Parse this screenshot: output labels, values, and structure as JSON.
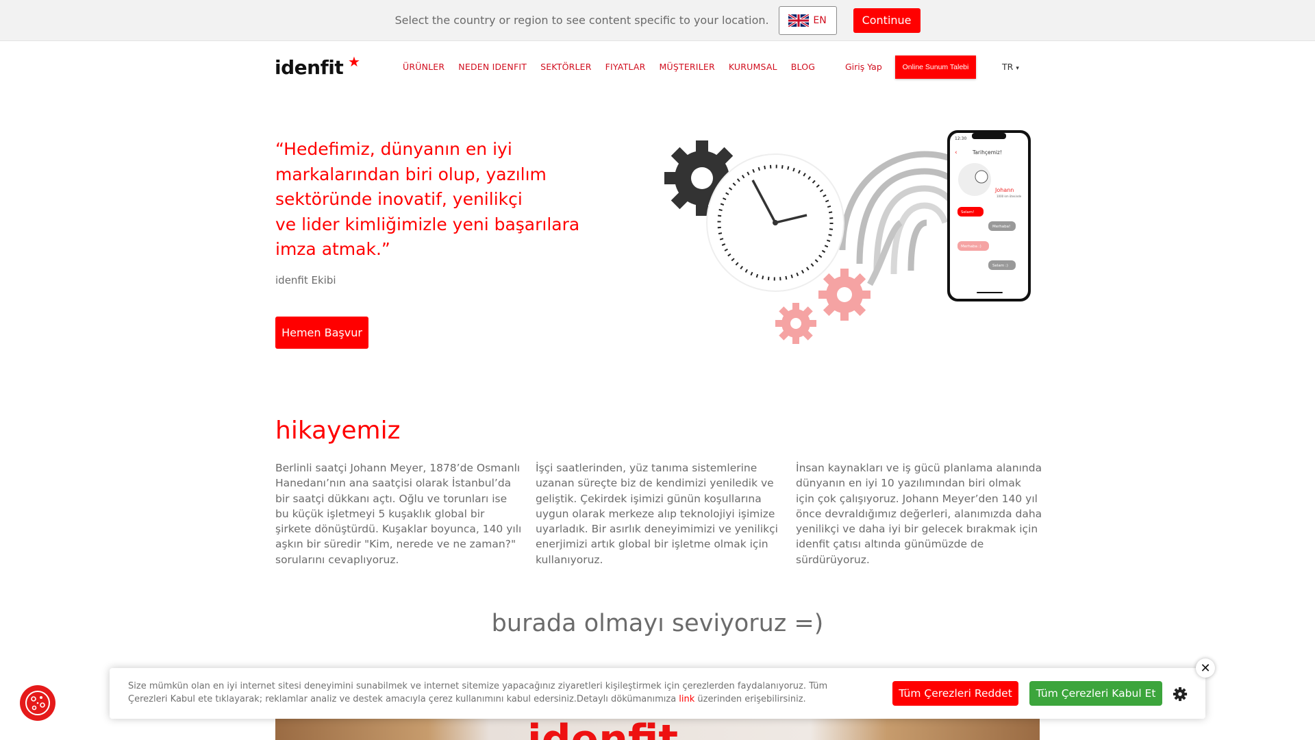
{
  "country_bar": {
    "message": "Select the country or region to see content specific to your location.",
    "language_code": "EN",
    "language_flag_icon": "uk-flag-icon",
    "continue_label": "Continue"
  },
  "header": {
    "logo": "idenfit",
    "nav": [
      "ÜRÜNLER",
      "NEDEN IDENFIT",
      "SEKTÖRLER",
      "FIYATLAR",
      "MÜŞTERILER",
      "KURUMSAL",
      "BLOG"
    ],
    "login_label": "Giriş Yap",
    "demo_button_label": "Online Sunum Talebi",
    "language_label": "TR"
  },
  "hero": {
    "quote_lines": [
      "“Hedefimiz, dünyanın en iyi",
      "markalarından biri olup, yazılım",
      "sektöründe inovatif, yenilikçi",
      "ve lider kimliğimizle yeni başarılara",
      "imza atmak.”"
    ],
    "author": "idenfit Ekibi",
    "apply_button_label": "Hemen Başvur",
    "phone_screen": {
      "time": "12:30",
      "title": "Tarihçemiz!",
      "name": "Johann",
      "subtitle": "1000 km ötesinde",
      "bubbles": [
        "Selam!",
        "Merhaba!",
        "Merhaba :)",
        "Selam :)"
      ]
    }
  },
  "story": {
    "title": "hikayemiz",
    "columns": [
      "Berlinli saatçi Johann Meyer, 1878’de Osmanlı Hanedanı’nın ana saatçisi olarak İstanbul’da bir saatçi dükkanı açtı. Oğlu ve torunları ise bu küçük işletmeyi 5 kuşaklık global bir şirkete dönüştürdü. Kuşaklar boyunca, 140 yılı aşkın bir süredir \"Kim, nerede ve ne zaman?\" sorularını cevaplıyoruz.",
      "İşçi saatlerinden, yüz tanıma sistemlerine uzanan süreçte biz de kendimizi yeniledik ve geliştik. Çekirdek işimizi günün koşullarına uygun olarak merkeze alıp teknolojiyi işimize uyarladık. Bir asırlık deneyimimizi ve yenilikçi enerjimizi artık global bir işletme olmak için kullanıyoruz.",
      "İnsan kaynakları ve iş gücü planlama alanında dünyanın en iyi 10 yazılımından biri olmak için çok çalışıyoruz. Johann Meyer’den 140 yıl önce devraldığımız değerleri, alanımızda daha yenilikçi ve daha iyi bir gelecek bırakmak için idenfit çatısı altında günümüzde de sürdürüyoruz."
    ]
  },
  "love_title": "burada olmayı seviyoruz =)",
  "photo_word": "idenfit",
  "cookie": {
    "text_before_link": "Size mümkün olan en iyi internet sitesi deneyimini sunabilmek ve internet sitemize yapacağınız ziyaretleri kişileştirmek için çerezlerden faydalanıyoruz. Tüm Çerezleri Kabul ete tıklayarak; reklamlar analiz ve destek amacıyla çerez kullanımını kabul edersiniz.Detaylı dökümanımıza ",
    "link_text": "link",
    "text_after_link": " üzerinden erişebilirsiniz.",
    "reject_label": "Tüm Çerezleri Reddet",
    "accept_label": "Tüm Çerezleri Kabul Et",
    "close_label": "✕"
  },
  "colors": {
    "brand_red": "#ff0000",
    "accept_green": "#3ca53c",
    "text_gray": "#6b6b6b"
  }
}
